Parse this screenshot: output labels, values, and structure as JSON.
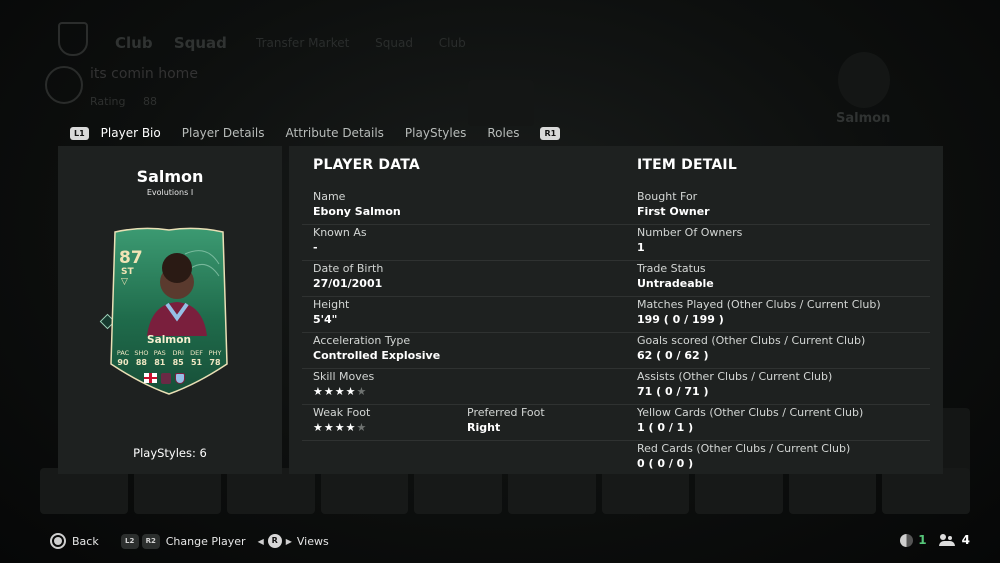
{
  "tabs": {
    "left_button": "L1",
    "right_button": "R1",
    "items": [
      "Player Bio",
      "Player Details",
      "Attribute Details",
      "PlayStyles",
      "Roles"
    ],
    "active": "Player Bio"
  },
  "player_panel": {
    "name": "Salmon",
    "version": "Evolutions I",
    "playstyles_text": "PlayStyles: 6"
  },
  "card": {
    "rating": "87",
    "position": "ST",
    "name": "Salmon",
    "stat_labels": [
      "PAC",
      "SHO",
      "PAS",
      "DRI",
      "DEF",
      "PHY"
    ],
    "stat_values": [
      "90",
      "88",
      "81",
      "85",
      "51",
      "78"
    ],
    "colors": {
      "card_green": "#1f6b4b",
      "card_light": "#3f9b73",
      "trim": "#e9dfb5"
    }
  },
  "player_data": {
    "title": "PLAYER DATA",
    "name_label": "Name",
    "name_value": "Ebony Salmon",
    "known_as_label": "Known As",
    "known_as_value": "-",
    "dob_label": "Date of Birth",
    "dob_value": "27/01/2001",
    "height_label": "Height",
    "height_value": "5'4\"",
    "accel_label": "Acceleration Type",
    "accel_value": "Controlled Explosive",
    "skill_moves_label": "Skill Moves",
    "skill_moves_rating": 4,
    "weak_foot_label": "Weak Foot",
    "weak_foot_rating": 4,
    "preferred_foot_label": "Preferred Foot",
    "preferred_foot_value": "Right"
  },
  "item_detail": {
    "title": "ITEM DETAIL",
    "rows": [
      {
        "label": "Bought For",
        "value": "First Owner"
      },
      {
        "label": "Number Of Owners",
        "value": "1"
      },
      {
        "label": "Trade Status",
        "value": "Untradeable"
      },
      {
        "label": "Matches Played (Other Clubs / Current Club)",
        "value": "199 ( 0 / 199 )"
      },
      {
        "label": "Goals scored (Other Clubs / Current Club)",
        "value": "62 ( 0 / 62 )"
      },
      {
        "label": "Assists (Other Clubs / Current Club)",
        "value": "71 ( 0 / 71 )"
      },
      {
        "label": "Yellow Cards (Other Clubs / Current Club)",
        "value": "1 ( 0 / 1 )"
      },
      {
        "label": "Red Cards (Other Clubs / Current Club)",
        "value": "0 ( 0 / 0 )"
      }
    ]
  },
  "bottom_bar": {
    "back_label": "Back",
    "l2": "L2",
    "r2": "R2",
    "change_player_label": "Change Player",
    "r_button": "R",
    "views_label": "Views",
    "count_green": "1",
    "count_users": "4"
  },
  "background": {
    "nav_items": [
      "Club",
      "Squad"
    ],
    "sub_items": [
      "Transfer Market",
      "Squad",
      "Club"
    ],
    "squad_name": "its comin home",
    "rating_label": "Rating",
    "rating_value": "88",
    "right_player_name": "Salmon"
  }
}
